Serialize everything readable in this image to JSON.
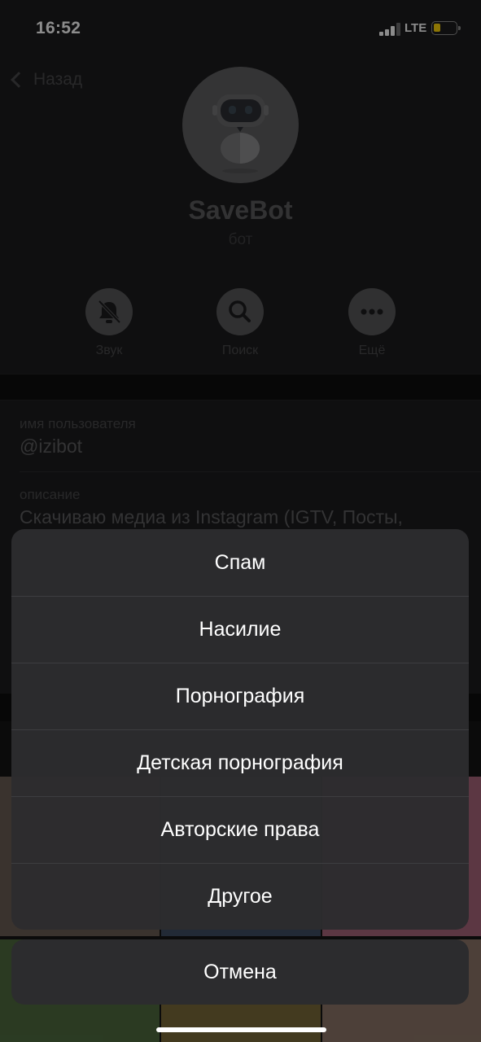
{
  "status_bar": {
    "time": "16:52",
    "network": "LTE",
    "battery_color": "#ffd60a"
  },
  "header": {
    "back_label": "Назад"
  },
  "profile": {
    "name": "SaveBot",
    "subtitle": "бот"
  },
  "actions": [
    {
      "label": "Звук",
      "icon": "bell-slash-icon"
    },
    {
      "label": "Поиск",
      "icon": "search-icon"
    },
    {
      "label": "Ещё",
      "icon": "more-icon"
    }
  ],
  "info": {
    "username_key": "имя пользователя",
    "username_value": "@izibot",
    "description_key": "описание",
    "description_value": "Скачиваю медиа из Instagram (IGTV, Посты,"
  },
  "report_sheet": {
    "options": [
      "Спам",
      "Насилие",
      "Порнография",
      "Детская порнография",
      "Авторские права",
      "Другое"
    ],
    "cancel_label": "Отмена"
  }
}
